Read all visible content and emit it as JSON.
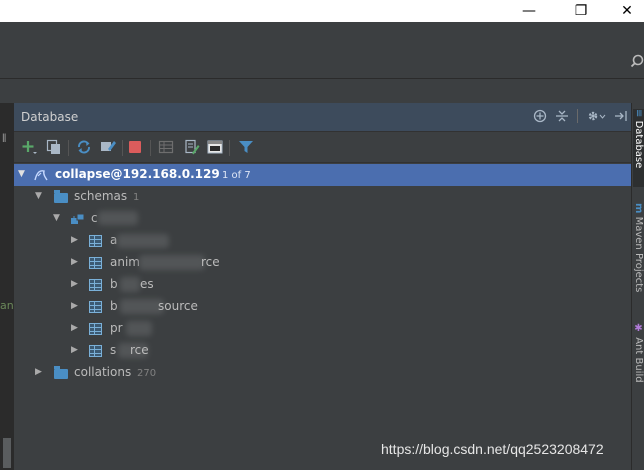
{
  "window": {
    "minimize_glyph": "—",
    "restore_glyph": "❐",
    "close_glyph": "✕"
  },
  "panel": {
    "title": "Database",
    "header_icons": [
      "add-source-icon",
      "collapse-icon",
      "settings-icon",
      "hide-icon"
    ],
    "toolbar": [
      "add-icon",
      "copy-icon",
      "refresh-icon",
      "properties-icon",
      "stop-icon",
      "table-view-icon",
      "edit-icon",
      "console-icon",
      "filter-icon"
    ]
  },
  "tree": {
    "connection": {
      "label": "collapse@192.168.0.129",
      "count": "1 of 7"
    },
    "schemas": {
      "label": "schemas",
      "count": "1"
    },
    "schema": {
      "label": "c"
    },
    "tables": [
      {
        "label": "a"
      },
      {
        "label": "anim",
        "suffix": "rce"
      },
      {
        "label": "b",
        "suffix": "es"
      },
      {
        "label": "b",
        "suffix": "source"
      },
      {
        "label": "pr"
      },
      {
        "label": "s",
        "suffix": "rce"
      }
    ],
    "collations": {
      "label": "collations",
      "count": "270"
    }
  },
  "sidebar_tabs": [
    "Database",
    "Maven Projects",
    "Ant Build"
  ],
  "left_code_fragment": "an",
  "watermark": "https://blog.csdn.net/qq2523208472",
  "colors": {
    "selection": "#4b6eaf",
    "background": "#3c3f41",
    "folder": "#4a8ec4"
  }
}
